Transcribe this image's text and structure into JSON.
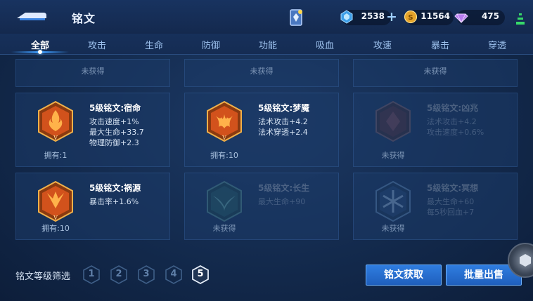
{
  "header": {
    "title": "铭文",
    "currencies": [
      {
        "icon": "diamond-icon",
        "value": "2538"
      },
      {
        "icon": "gold-coin-icon",
        "value": "11564"
      },
      {
        "icon": "gem-icon",
        "value": "475"
      }
    ]
  },
  "tabs": [
    {
      "label": "全部",
      "active": true
    },
    {
      "label": "攻击"
    },
    {
      "label": "生命"
    },
    {
      "label": "防御"
    },
    {
      "label": "功能"
    },
    {
      "label": "吸血"
    },
    {
      "label": "攻速"
    },
    {
      "label": "暴击"
    },
    {
      "label": "穿透"
    }
  ],
  "top_row": [
    "未获得",
    "未获得",
    "未获得"
  ],
  "runes": [
    {
      "name": "5级铭文:宿命",
      "stats": [
        "攻击速度+1%",
        "最大生命+33.7",
        "物理防御+2.3"
      ],
      "owned": "拥有:1",
      "color": "red"
    },
    {
      "name": "5级铭文:梦魇",
      "stats": [
        "法术攻击+4.2",
        "法术穿透+2.4"
      ],
      "owned": "拥有:10",
      "color": "red"
    },
    {
      "name": "5级铭文:凶兆",
      "stats": [
        "法术攻击+4.2",
        "攻击速度+0.6%"
      ],
      "owned": "未获得",
      "color": "red"
    },
    {
      "name": "5级铭文:祸源",
      "stats": [
        "暴击率+1.6%"
      ],
      "owned": "拥有:10",
      "color": "red"
    },
    {
      "name": "5级铭文:长生",
      "stats": [
        "最大生命+90"
      ],
      "owned": "未获得",
      "color": "green"
    },
    {
      "name": "5级铭文:冥想",
      "stats": [
        "最大生命+60",
        "每5秒回血+7"
      ],
      "owned": "未获得",
      "color": "blue"
    }
  ],
  "filter": {
    "label": "铭文等级筛选",
    "levels": [
      "1",
      "2",
      "3",
      "4",
      "5"
    ],
    "selected": "5"
  },
  "buttons": {
    "acquire": "铭文获取",
    "bulk_sell": "批量出售"
  }
}
